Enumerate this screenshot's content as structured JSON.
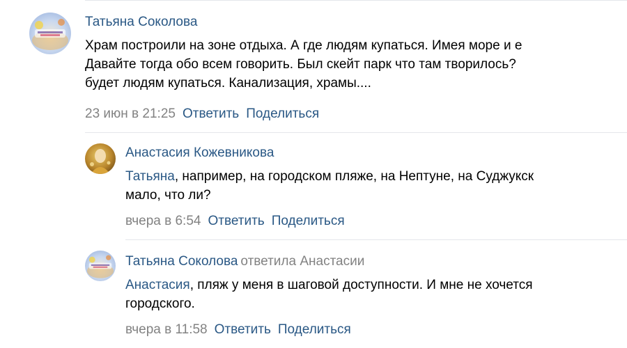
{
  "comments": [
    {
      "author": "Татьяна Соколова",
      "avatar_icon": "autumn-collage-avatar",
      "lines": [
        "Храм построили на зоне отдыха. А где людям купаться. Имея море и е",
        "Давайте тогда обо всем говорить. Был скейт парк что там творилось?",
        "будет людям купаться. Канализация, храмы...."
      ],
      "timestamp": "23 июн в 21:25",
      "reply_label": "Ответить",
      "share_label": "Поделиться"
    },
    {
      "author": "Анастасия Кожевникова",
      "avatar_icon": "gold-portrait-avatar",
      "mention": "Татьяна",
      "lines": [
        ", например, на городском пляже, на Нептуне, на Суджукск",
        "мало, что ли?"
      ],
      "timestamp": "вчера в 6:54",
      "reply_label": "Ответить",
      "share_label": "Поделиться"
    },
    {
      "author": "Татьяна Соколова",
      "reply_note": "ответила Анастасии",
      "avatar_icon": "autumn-collage-avatar",
      "mention": "Анастасия",
      "lines": [
        ", пляж у меня в шаговой доступности. И мне не хочется",
        "городского."
      ],
      "timestamp": "вчера в 11:58",
      "reply_label": "Ответить",
      "share_label": "Поделиться"
    }
  ],
  "colors": {
    "link": "#2a5885",
    "secondary": "#828282",
    "text": "#000000",
    "divider": "#e4e6ea"
  }
}
